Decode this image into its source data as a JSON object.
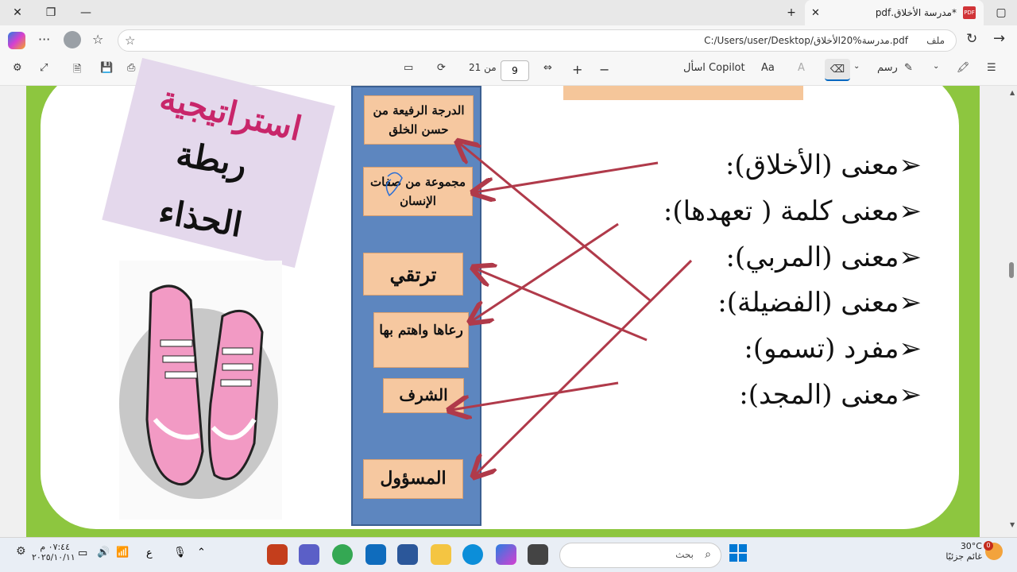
{
  "browser": {
    "tab_title": "*مدرسة الأخلاق.pdf",
    "pdf_badge": "PDF",
    "address_label": "ملف",
    "url": "C:/Users/user/Desktop/مدرسة%20الأخلاق.pdf"
  },
  "toolbar": {
    "page_current": "9",
    "page_total_label": "من 21",
    "ask_copilot": "اسأل Copilot",
    "draw_label": "رسم"
  },
  "document": {
    "strategy_title": "استراتيجية",
    "strategy_line1": "ربطة",
    "strategy_line2": "الحذاء",
    "answers": [
      "الدرجة الرفيعة من حسن الخلق",
      "مجموعة من صفات الإنسان",
      "ترتقي",
      "رعاها واهتم بها",
      "الشرف",
      "المسؤول"
    ],
    "questions": [
      "معنى (الأخلاق):",
      "معنى كلمة ( تعهدها):",
      "معنى (المربي):",
      "معنى (الفضيلة):",
      "مفرد (تسمو):",
      "معنى (المجد):"
    ],
    "bullet_glyph": "➢"
  },
  "taskbar": {
    "weather_temp": "30°C",
    "weather_desc": "غائم جزئيًا",
    "search_placeholder": "بحث",
    "time": "٠٧:٤٤ م",
    "date": "٢٠٢٥/١٠/١١",
    "lang": "ع",
    "notification_count": "0"
  },
  "colors": {
    "page_border": "#8dc63f",
    "blue_column": "#5d86bf",
    "answer_box": "#f6c8a0",
    "arrow": "#b03a4a",
    "strategy_pink": "#c8266a"
  }
}
